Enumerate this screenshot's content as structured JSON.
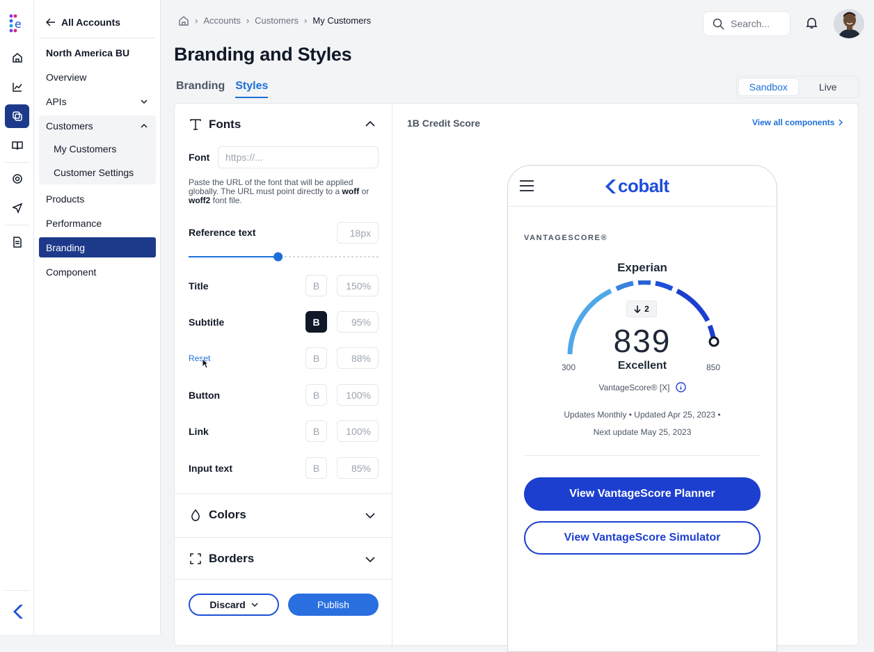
{
  "brand": {
    "accent": "#1d6fd8",
    "nav_active": "#1d3a8a",
    "primary_button": "#1d3fcf"
  },
  "nav": {
    "back_label": "All Accounts",
    "org_name": "North America BU",
    "items": [
      {
        "label": "Overview"
      },
      {
        "label": "APIs"
      },
      {
        "label": "Customers"
      },
      {
        "label": "My Customers"
      },
      {
        "label": "Customer Settings"
      },
      {
        "label": "Products"
      },
      {
        "label": "Performance"
      },
      {
        "label": "Branding"
      },
      {
        "label": "Component"
      }
    ]
  },
  "header": {
    "breadcrumb": [
      "Accounts",
      "Customers",
      "My Customers"
    ],
    "search_placeholder": "Search...",
    "title": "Branding and Styles",
    "tabs": [
      "Branding",
      "Styles"
    ],
    "env_toggle": [
      "Sandbox",
      "Live"
    ]
  },
  "fonts": {
    "section_title": "Fonts",
    "font_label": "Font",
    "font_placeholder": "https://...",
    "help_before_woff": "Paste the URL of the font that will be applied globally. The URL must point directly to a ",
    "help_woff": "woff",
    "help_or": " or ",
    "help_woff2": "woff2",
    "help_after": " font file.",
    "reference_label": "Reference text",
    "reference_size": "18px",
    "reference_slider_fraction": 0.47,
    "bold_glyph": "B",
    "rows": [
      {
        "label": "Title",
        "size": "150%",
        "bold": false
      },
      {
        "label": "Subtitle",
        "size": "95%",
        "bold": true
      },
      {
        "label": "Reset",
        "size": "88%",
        "bold": false
      },
      {
        "label": "Button",
        "size": "100%",
        "bold": false
      },
      {
        "label": "Link",
        "size": "100%",
        "bold": false
      },
      {
        "label": "Input text",
        "size": "85%",
        "bold": false
      }
    ]
  },
  "colors_section": "Colors",
  "borders_section": "Borders",
  "actions": {
    "discard": "Discard",
    "publish": "Publish"
  },
  "preview": {
    "component_title": "1B Credit Score",
    "view_all": "View all components",
    "logo_text": "cobalt",
    "score_brand": "VANTAGESCORE®",
    "bureau": "Experian",
    "change": "2",
    "score": "839",
    "rating": "Excellent",
    "range_min": "300",
    "range_max": "850",
    "model": "VantageScore® [X]",
    "updates_line1": "Updates Monthly • Updated Apr 25, 2023 •",
    "updates_line2": "Next update May 25, 2023",
    "btn_planner": "View VantageScore Planner",
    "btn_simulator": "View VantageScore Simulator"
  }
}
